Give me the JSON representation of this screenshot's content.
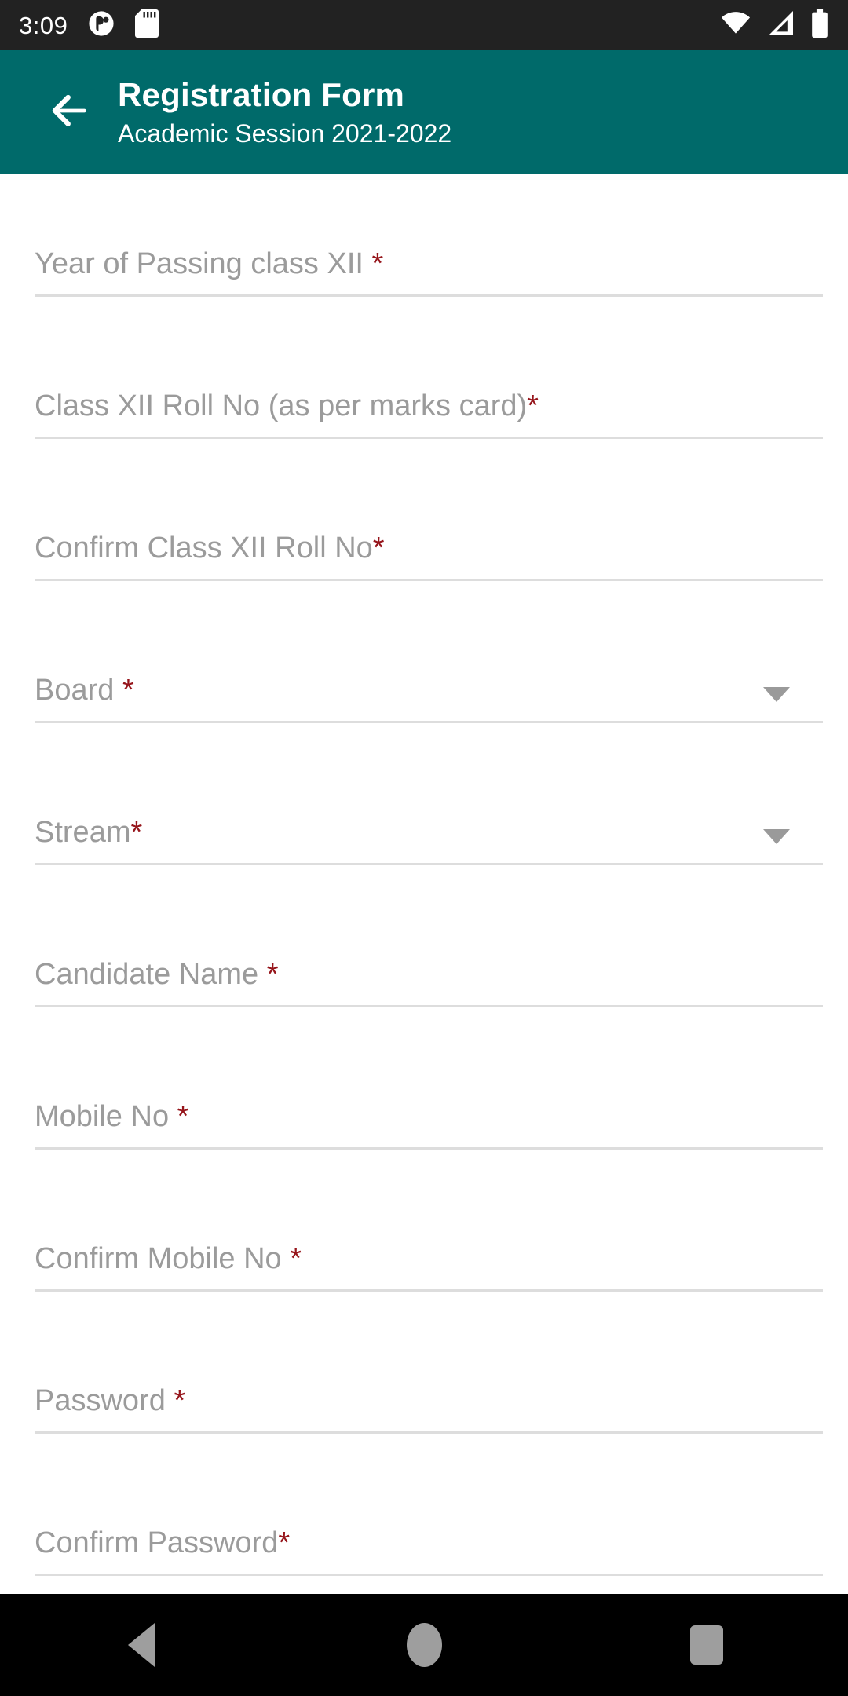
{
  "status_bar": {
    "time": "3:09",
    "left_icons": [
      "app-notification-icon",
      "sd-card-icon"
    ],
    "right_icons": [
      "wifi-icon",
      "cellular-signal-icon",
      "battery-icon"
    ]
  },
  "app_bar": {
    "back_icon": "back-arrow-icon",
    "title": "Registration Form",
    "subtitle": "Academic Session 2021-2022",
    "background_color": "#006a6a",
    "text_color": "#ffffff"
  },
  "form": {
    "required_marker": "*",
    "required_color": "#96151b",
    "label_color": "#9b9b9b",
    "underline_color": "#dddddd",
    "fields": [
      {
        "label": "Year of Passing class XII ",
        "type": "text",
        "value": "",
        "placeholder": "Year of Passing class XII"
      },
      {
        "label": "Class XII Roll No (as per marks card)",
        "type": "text",
        "value": "",
        "placeholder": "Class XII Roll No (as per marks card)"
      },
      {
        "label": "Confirm Class XII Roll No",
        "type": "text",
        "value": "",
        "placeholder": "Confirm Class XII Roll No"
      },
      {
        "label": "Board ",
        "type": "dropdown",
        "value": "",
        "placeholder": "Board"
      },
      {
        "label": "Stream",
        "type": "dropdown",
        "value": "",
        "placeholder": "Stream"
      },
      {
        "label": "Candidate Name ",
        "type": "text",
        "value": "",
        "placeholder": "Candidate Name"
      },
      {
        "label": "Mobile No ",
        "type": "tel",
        "value": "",
        "placeholder": "Mobile No"
      },
      {
        "label": "Confirm Mobile No ",
        "type": "tel",
        "value": "",
        "placeholder": "Confirm Mobile No"
      },
      {
        "label": "Password ",
        "type": "password",
        "value": "",
        "placeholder": "Password"
      },
      {
        "label": "Confirm Password",
        "type": "password",
        "value": "",
        "placeholder": "Confirm Password"
      }
    ]
  },
  "nav_bar": {
    "back_label": "Back",
    "home_label": "Home",
    "recents_label": "Recents"
  }
}
